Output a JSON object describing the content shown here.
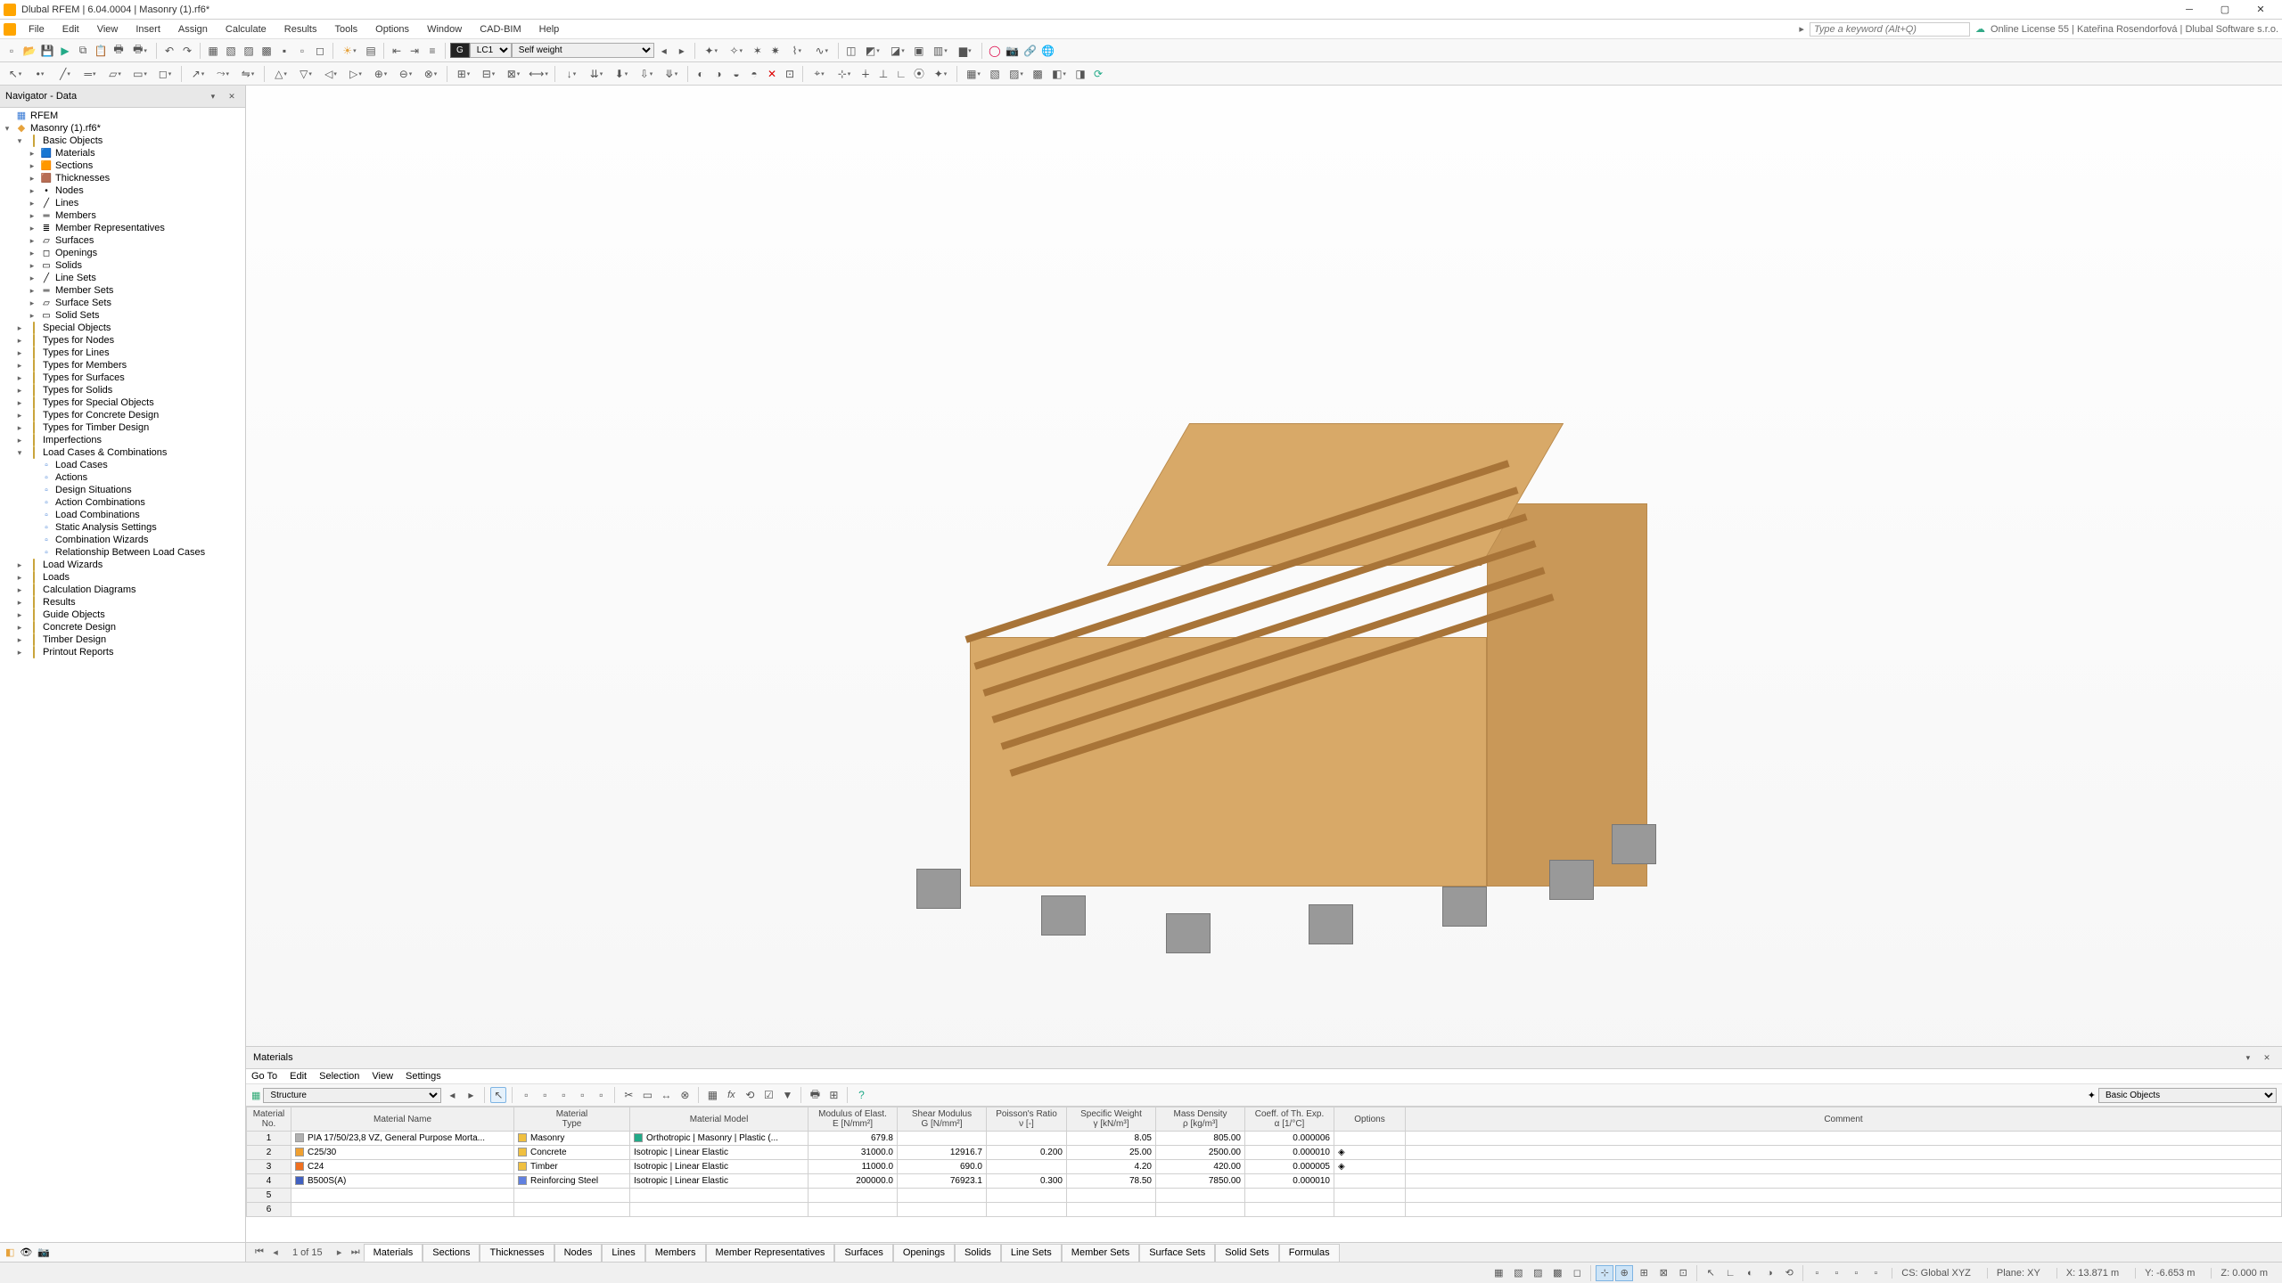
{
  "titlebar": {
    "title": "Dlubal RFEM | 6.04.0004 | Masonry (1).rf6*"
  },
  "menubar": {
    "items": [
      "File",
      "Edit",
      "View",
      "Insert",
      "Assign",
      "Calculate",
      "Results",
      "Tools",
      "Options",
      "Window",
      "CAD-BIM",
      "Help"
    ],
    "search_placeholder": "Type a keyword (Alt+Q)",
    "license": "Online License 55 | Kateřina Rosendorfová | Dlubal Software s.r.o."
  },
  "toolbar1": {
    "lc_code": "LC1",
    "lc_name": "Self weight"
  },
  "navigator": {
    "title": "Navigator - Data",
    "root": "RFEM",
    "model": "Masonry (1).rf6*",
    "basic_objects": "Basic Objects",
    "basic_children": [
      "Materials",
      "Sections",
      "Thicknesses",
      "Nodes",
      "Lines",
      "Members",
      "Member Representatives",
      "Surfaces",
      "Openings",
      "Solids",
      "Line Sets",
      "Member Sets",
      "Surface Sets",
      "Solid Sets"
    ],
    "mid_groups": [
      "Special Objects",
      "Types for Nodes",
      "Types for Lines",
      "Types for Members",
      "Types for Surfaces",
      "Types for Solids",
      "Types for Special Objects",
      "Types for Concrete Design",
      "Types for Timber Design",
      "Imperfections"
    ],
    "lcc": "Load Cases & Combinations",
    "lcc_children": [
      "Load Cases",
      "Actions",
      "Design Situations",
      "Action Combinations",
      "Load Combinations",
      "Static Analysis Settings",
      "Combination Wizards",
      "Relationship Between Load Cases"
    ],
    "tail_groups": [
      "Load Wizards",
      "Loads",
      "Calculation Diagrams",
      "Results",
      "Guide Objects",
      "Concrete Design",
      "Timber Design",
      "Printout Reports"
    ]
  },
  "materials_panel": {
    "title": "Materials",
    "menu": [
      "Go To",
      "Edit",
      "Selection",
      "View",
      "Settings"
    ],
    "filter_structure": "Structure",
    "filter_group": "Basic Objects",
    "headers": {
      "no": "Material\nNo.",
      "name": "Material Name",
      "type": "Material\nType",
      "model": "Material Model",
      "e": "Modulus of Elast.\nE [N/mm²]",
      "g": "Shear Modulus\nG [N/mm²]",
      "nu": "Poisson's Ratio\nν [-]",
      "gamma": "Specific Weight\nγ [kN/m³]",
      "rho": "Mass Density\nρ [kg/m³]",
      "alpha": "Coeff. of Th. Exp.\nα [1/°C]",
      "options": "Options",
      "comment": "Comment"
    },
    "rows": [
      {
        "no": "1",
        "swatch": "#b0b0b0",
        "name": "PIA 17/50/23,8 VZ, General Purpose Morta...",
        "type_sw": "#f0c040",
        "type": "Masonry",
        "model_sw": "#2a8",
        "model": "Orthotropic | Masonry | Plastic (...",
        "e": "679.8",
        "g": "",
        "nu": "",
        "gamma": "8.05",
        "rho": "805.00",
        "alpha": "0.000006",
        "opt": ""
      },
      {
        "no": "2",
        "swatch": "#f0a030",
        "name": "C25/30",
        "type_sw": "#f0c040",
        "type": "Concrete",
        "model_sw": "",
        "model": "Isotropic | Linear Elastic",
        "e": "31000.0",
        "g": "12916.7",
        "nu": "0.200",
        "gamma": "25.00",
        "rho": "2500.00",
        "alpha": "0.000010",
        "opt": "◈"
      },
      {
        "no": "3",
        "swatch": "#f07020",
        "name": "C24",
        "type_sw": "#f0c040",
        "type": "Timber",
        "model_sw": "",
        "model": "Isotropic | Linear Elastic",
        "e": "11000.0",
        "g": "690.0",
        "nu": "",
        "gamma": "4.20",
        "rho": "420.00",
        "alpha": "0.000005",
        "opt": "◈"
      },
      {
        "no": "4",
        "swatch": "#4060c0",
        "name": "B500S(A)",
        "type_sw": "#6080e0",
        "type": "Reinforcing Steel",
        "model_sw": "",
        "model": "Isotropic | Linear Elastic",
        "e": "200000.0",
        "g": "76923.1",
        "nu": "0.300",
        "gamma": "78.50",
        "rho": "7850.00",
        "alpha": "0.000010",
        "opt": ""
      }
    ],
    "empty_rows": [
      "5",
      "6"
    ]
  },
  "tabs": {
    "pager": "1 of 15",
    "items": [
      "Materials",
      "Sections",
      "Thicknesses",
      "Nodes",
      "Lines",
      "Members",
      "Member Representatives",
      "Surfaces",
      "Openings",
      "Solids",
      "Line Sets",
      "Member Sets",
      "Surface Sets",
      "Solid Sets",
      "Formulas"
    ]
  },
  "statusbar": {
    "cs": "CS: Global XYZ",
    "plane": "Plane: XY",
    "x": "X: 13.871 m",
    "y": "Y: -6.653 m",
    "z": "Z: 0.000 m"
  }
}
